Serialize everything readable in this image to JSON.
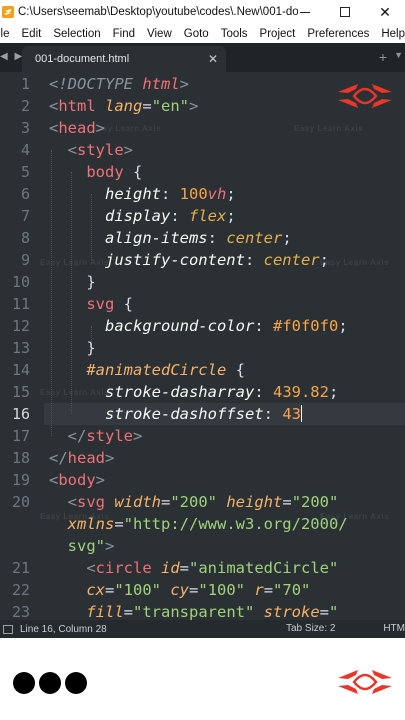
{
  "window": {
    "title": "C:\\Users\\seemab\\Desktop\\youtube\\codes\\.New\\001-doc...",
    "minimize_glyph": "",
    "maximize_glyph": "",
    "close_glyph": "✕"
  },
  "menu": [
    "ile",
    "Edit",
    "Selection",
    "Find",
    "View",
    "Goto",
    "Tools",
    "Project",
    "Preferences",
    "Help"
  ],
  "tabs": {
    "nav_glyph": "◀ ▶",
    "active": "001-document.html",
    "close_glyph": "✕",
    "add_glyph": "+",
    "more_glyph": "▼"
  },
  "editor": {
    "active_line": 16,
    "watermark": "Easy Learn Axis",
    "gutter": [
      "1",
      "2",
      "3",
      "4",
      "5",
      "6",
      "7",
      "8",
      "9",
      "10",
      "11",
      "12",
      "13",
      "14",
      "15",
      "16",
      "17",
      "18",
      "19",
      "20",
      "",
      "",
      "21",
      "22",
      "23"
    ],
    "lines": [
      [
        [
          "t-gray",
          "<"
        ],
        [
          "t-gray t-it",
          "!DOCTYPE "
        ],
        [
          "t-pk",
          "html"
        ],
        [
          "t-gray",
          ">"
        ]
      ],
      [
        [
          "t-gray",
          "<"
        ],
        [
          "t-tag",
          "html "
        ],
        [
          "t-attr",
          "lang"
        ],
        [
          "t-punc",
          "="
        ],
        [
          "t-str",
          "\"en\""
        ],
        [
          "t-gray",
          ">"
        ]
      ],
      [
        [
          "t-gray",
          "<"
        ],
        [
          "t-tag",
          "head"
        ],
        [
          "t-gray",
          ">"
        ]
      ],
      [
        [
          "t-gray",
          "  <"
        ],
        [
          "t-tag",
          "style"
        ],
        [
          "t-gray",
          ">"
        ]
      ],
      [
        [
          "t-tag",
          "    body "
        ],
        [
          "t-punc",
          "{"
        ]
      ],
      [
        [
          "t-prop",
          "      height"
        ],
        [
          "t-punc",
          ": "
        ],
        [
          "t-num",
          "100"
        ],
        [
          "t-pk",
          "vh"
        ],
        [
          "t-punc",
          ";"
        ]
      ],
      [
        [
          "t-prop",
          "      display"
        ],
        [
          "t-punc",
          ": "
        ],
        [
          "t-kw",
          "flex"
        ],
        [
          "t-punc",
          ";"
        ]
      ],
      [
        [
          "t-prop",
          "      align-items"
        ],
        [
          "t-punc",
          ": "
        ],
        [
          "t-kw",
          "center"
        ],
        [
          "t-punc",
          ";"
        ]
      ],
      [
        [
          "t-prop",
          "      justify-content"
        ],
        [
          "t-punc",
          ": "
        ],
        [
          "t-kw",
          "center"
        ],
        [
          "t-punc",
          ";"
        ]
      ],
      [
        [
          "t-punc",
          "    }"
        ]
      ],
      [
        [
          "t-tag",
          "    svg "
        ],
        [
          "t-punc",
          "{"
        ]
      ],
      [
        [
          "t-prop",
          "      background-color"
        ],
        [
          "t-punc",
          ": "
        ],
        [
          "t-num",
          "#f0f0f0"
        ],
        [
          "t-punc",
          ";"
        ]
      ],
      [
        [
          "t-punc",
          "    }"
        ]
      ],
      [
        [
          "t-attr",
          "    #animatedCircle "
        ],
        [
          "t-punc",
          "{"
        ]
      ],
      [
        [
          "t-prop",
          "      stroke-dasharray"
        ],
        [
          "t-punc",
          ": "
        ],
        [
          "t-num",
          "439.82"
        ],
        [
          "t-punc",
          ";"
        ]
      ],
      [
        [
          "t-prop",
          "      stroke-dashoffset"
        ],
        [
          "t-punc",
          ": "
        ],
        [
          "t-num",
          "43"
        ]
      ],
      [
        [
          "t-gray",
          "  </"
        ],
        [
          "t-tag",
          "style"
        ],
        [
          "t-gray",
          ">"
        ]
      ],
      [
        [
          "t-gray",
          "</"
        ],
        [
          "t-tag",
          "head"
        ],
        [
          "t-gray",
          ">"
        ]
      ],
      [
        [
          "t-gray",
          "<"
        ],
        [
          "t-tag",
          "body"
        ],
        [
          "t-gray",
          ">"
        ]
      ],
      [
        [
          "t-gray",
          "  <"
        ],
        [
          "t-tag",
          "svg "
        ],
        [
          "t-attr",
          "width"
        ],
        [
          "t-punc",
          "="
        ],
        [
          "t-str",
          "\"200\" "
        ],
        [
          "t-attr",
          "height"
        ],
        [
          "t-punc",
          "="
        ],
        [
          "t-str",
          "\"200\""
        ]
      ],
      [
        [
          "t-attr",
          "  xmlns"
        ],
        [
          "t-punc",
          "="
        ],
        [
          "t-str",
          "\"http://www.w3.org/2000/"
        ]
      ],
      [
        [
          "t-str",
          "  svg\""
        ],
        [
          "t-gray",
          ">"
        ]
      ],
      [
        [
          "t-gray",
          "    <"
        ],
        [
          "t-tag",
          "circle "
        ],
        [
          "t-attr",
          "id"
        ],
        [
          "t-punc",
          "="
        ],
        [
          "t-str",
          "\"animatedCircle\""
        ]
      ],
      [
        [
          "t-attr",
          "    cx"
        ],
        [
          "t-punc",
          "="
        ],
        [
          "t-str",
          "\"100\" "
        ],
        [
          "t-attr",
          "cy"
        ],
        [
          "t-punc",
          "="
        ],
        [
          "t-str",
          "\"100\" "
        ],
        [
          "t-attr",
          "r"
        ],
        [
          "t-punc",
          "="
        ],
        [
          "t-str",
          "\"70\""
        ]
      ],
      [
        [
          "t-attr",
          "    fill"
        ],
        [
          "t-punc",
          "="
        ],
        [
          "t-str",
          "\"transparent\" "
        ],
        [
          "t-attr",
          "stroke"
        ],
        [
          "t-punc",
          "="
        ],
        [
          "t-str",
          "\""
        ]
      ]
    ]
  },
  "status": {
    "position": "Line 16, Column 28",
    "tab_size": "Tab Size: 2",
    "syntax": "HTM"
  },
  "colors": {
    "accent": "#e8362a",
    "editor_bg": "#2b3035"
  }
}
